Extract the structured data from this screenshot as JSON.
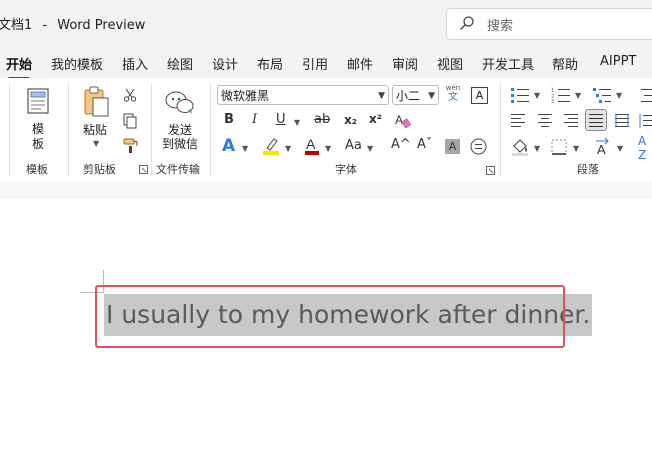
{
  "titlebar": {
    "doc_name": "文档1",
    "separator": "-",
    "app_name": "Word Preview",
    "search_placeholder": "搜索"
  },
  "tabs": [
    "开始",
    "我的模板",
    "插入",
    "绘图",
    "设计",
    "布局",
    "引用",
    "邮件",
    "审阅",
    "视图",
    "开发工具",
    "帮助",
    "AIPPT"
  ],
  "active_tab": "开始",
  "ribbon": {
    "template": {
      "button_line1": "模",
      "button_line2": "板",
      "group_label": "模板"
    },
    "clipboard": {
      "paste_label": "粘贴",
      "group_label": "剪贴板"
    },
    "file_transfer": {
      "button_line1": "发送",
      "button_line2": "到微信",
      "group_label": "文件传输"
    },
    "font": {
      "font_name": "微软雅黑",
      "font_size": "小二",
      "phonetic_top": "wén",
      "phonetic_bottom": "文",
      "char_border": "A",
      "bold": "B",
      "italic": "I",
      "underline": "U",
      "strike": "ab",
      "subscript": "x₂",
      "superscript": "x²",
      "change_case": "Aa",
      "grow": "A^",
      "shrink": "Aˇ",
      "group_label": "字体",
      "highlight_color": "#f5e600",
      "font_color": "#c00000"
    },
    "paragraph": {
      "group_label": "段落"
    }
  },
  "document": {
    "sentence": "I usually to my homework after dinner.",
    "highlight_border_color": "#e0505f"
  }
}
